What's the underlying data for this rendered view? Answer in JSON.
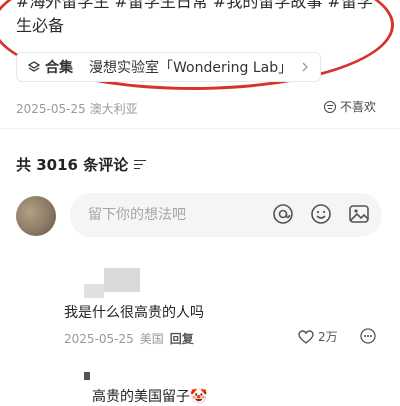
{
  "post": {
    "hashtags": "#海外留学生 #留学生日常 #我的留学故事 #留学生必备",
    "collection_label": "合集",
    "collection_name": "漫想实验室「Wondering Lab」",
    "date": "2025-05-25",
    "location": "澳大利亚",
    "dislike_label": "不喜欢"
  },
  "comments_header": {
    "title": "共 3016 条评论"
  },
  "input": {
    "placeholder": "留下你的想法吧"
  },
  "comments": [
    {
      "text": "我是什么很高贵的人吗",
      "date": "2025-05-25",
      "location": "美国",
      "reply_label": "回复",
      "likes": "2万"
    }
  ],
  "sub_comment": {
    "text": "高贵的美国留子🤡"
  },
  "colors": {
    "annotation_red": "#d6332a",
    "input_bg": "#f5f5f5",
    "meta_gray": "#9a9a9a"
  }
}
